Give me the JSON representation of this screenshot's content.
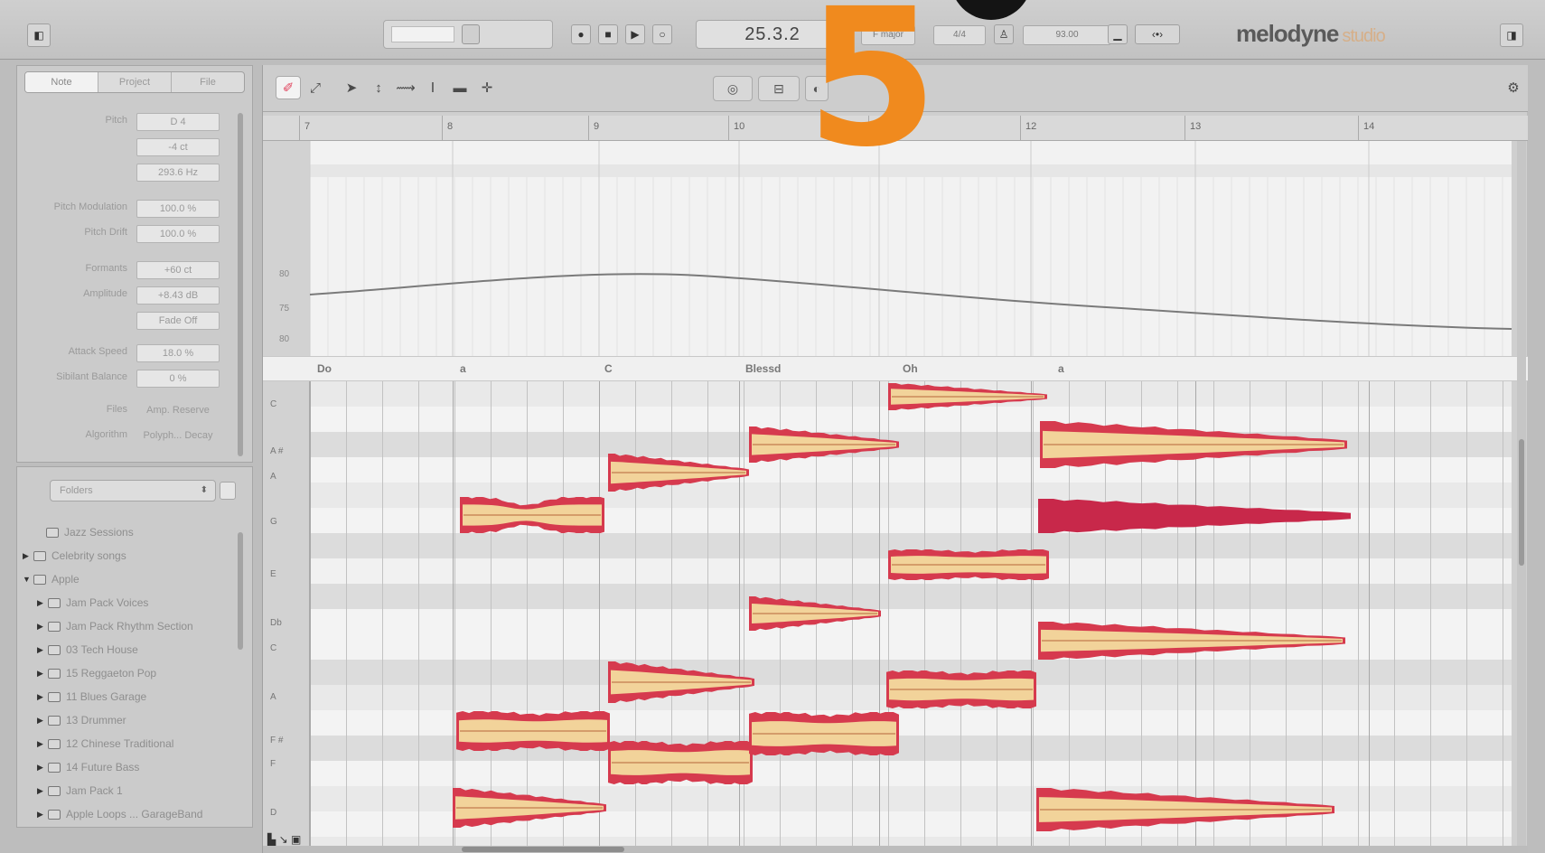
{
  "topbar": {
    "position": "25.3.2",
    "key": "F major",
    "time_signature": "4/4",
    "tempo": "93.00",
    "logo": "melodyne",
    "logo_edition": "studio",
    "overlay_number": "5"
  },
  "inspector": {
    "tabs": [
      "Note",
      "Project",
      "File"
    ],
    "active_tab": 0,
    "params": [
      {
        "label": "Pitch",
        "value": "D 4"
      },
      {
        "label": "",
        "value": "-4 ct"
      },
      {
        "label": "",
        "value": "293.6 Hz"
      },
      {
        "label": "Pitch Modulation",
        "value": "100.0 %"
      },
      {
        "label": "Pitch Drift",
        "value": "100.0 %"
      },
      {
        "label": "Formants",
        "value": "+60 ct"
      },
      {
        "label": "Amplitude",
        "value": "+8.43 dB"
      },
      {
        "label": "",
        "value": "Fade Off"
      },
      {
        "label": "Attack Speed",
        "value": "18.0 %"
      },
      {
        "label": "Sibilant Balance",
        "value": "0 %"
      },
      {
        "label": "Files",
        "value": "Amp. Reserve"
      },
      {
        "label": "Algorithm",
        "value": "Polyph... Decay"
      }
    ]
  },
  "browser": {
    "selector": "Folders",
    "items": [
      {
        "label": "Jazz Sessions",
        "arrow": "",
        "indent": 0
      },
      {
        "label": "Celebrity songs",
        "arrow": "▶",
        "indent": 0
      },
      {
        "label": "Apple",
        "arrow": "▼",
        "indent": 0
      },
      {
        "label": "Jam Pack Voices",
        "arrow": "▶",
        "indent": 1
      },
      {
        "label": "Jam Pack Rhythm Section",
        "arrow": "▶",
        "indent": 1
      },
      {
        "label": "03 Tech House",
        "arrow": "▶",
        "indent": 1
      },
      {
        "label": "15 Reggaeton Pop",
        "arrow": "▶",
        "indent": 1
      },
      {
        "label": "11 Blues Garage",
        "arrow": "▶",
        "indent": 1
      },
      {
        "label": "13 Drummer",
        "arrow": "▶",
        "indent": 1
      },
      {
        "label": "12 Chinese Traditional",
        "arrow": "▶",
        "indent": 1
      },
      {
        "label": "14 Future Bass",
        "arrow": "▶",
        "indent": 1
      },
      {
        "label": "Jam Pack 1",
        "arrow": "▶",
        "indent": 1
      },
      {
        "label": "Apple Loops ... GarageBand",
        "arrow": "▶",
        "indent": 1
      }
    ]
  },
  "editor": {
    "bars": [
      "7",
      "8",
      "9",
      "10",
      "11",
      "12",
      "13",
      "14"
    ],
    "lyrics": [
      "Do",
      "a",
      "C",
      "Blessd",
      "Oh",
      "a"
    ],
    "keys": [
      "C",
      "A #",
      "A",
      "G",
      "E",
      "Db",
      "C",
      "A",
      "F #",
      "F",
      "D"
    ],
    "tempo_lane_labels": [
      "80",
      "75",
      "80"
    ]
  },
  "colors": {
    "accent_orange": "#f08a1e",
    "blob_outer": "#d63a4e",
    "blob_inner": "#f2d39a",
    "blob_selected": "#c8284a"
  }
}
